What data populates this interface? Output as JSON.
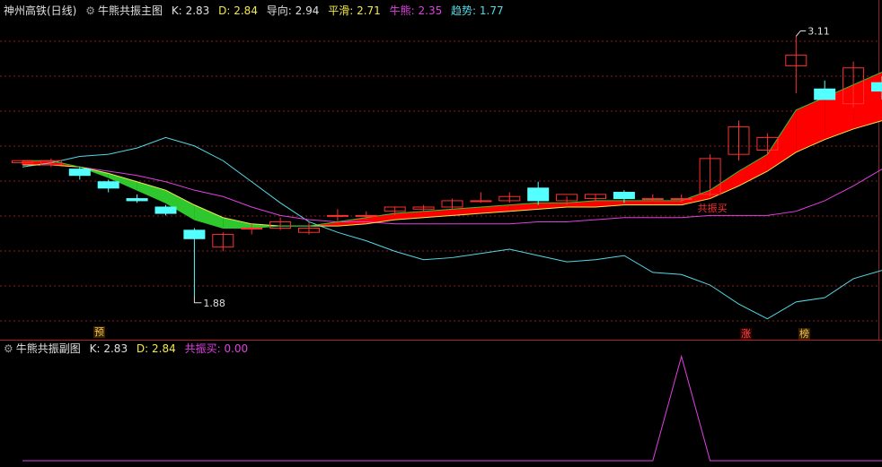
{
  "main_header": {
    "stock": "神州高铁(日线)",
    "indicator": "牛熊共振主图",
    "k_label": "K:",
    "k_value": "2.83",
    "d_label": "D:",
    "d_value": "2.84",
    "guide_label": "导向:",
    "guide_value": "2.94",
    "smooth_label": "平滑:",
    "smooth_value": "2.71",
    "bull_label": "牛熊:",
    "bull_value": "2.35",
    "trend_label": "趋势:",
    "trend_value": "1.77"
  },
  "sub_header": {
    "indicator": "牛熊共振副图",
    "k_label": "K:",
    "k_value": "2.83",
    "d_label": "D:",
    "d_value": "2.84",
    "buy_label": "共振买:",
    "buy_value": "0.00"
  },
  "markers": {
    "pre": "预",
    "rise": "涨",
    "rank": "榜"
  },
  "annotations": {
    "high": "3.11",
    "low": "1.88",
    "buy_signal": "共振买"
  },
  "colors": {
    "up": "#ff3030",
    "down": "#54ffff",
    "bull_ribbon": "#ff0000",
    "bear_ribbon": "#2ec82e",
    "guide": "#f2e94e",
    "bull_line": "#e040e0",
    "trend": "#52d9e6",
    "grid": "#8b1e1e",
    "sub_line": "#e040e0"
  },
  "chart_data": [
    {
      "type": "candlestick",
      "title": "牛熊共振主图",
      "ylim": [
        1.76,
        3.18
      ],
      "candles": [
        {
          "o": 2.51,
          "h": 2.52,
          "l": 2.5,
          "c": 2.52
        },
        {
          "o": 2.5,
          "h": 2.53,
          "l": 2.49,
          "c": 2.52
        },
        {
          "o": 2.48,
          "h": 2.49,
          "l": 2.43,
          "c": 2.45
        },
        {
          "o": 2.42,
          "h": 2.43,
          "l": 2.37,
          "c": 2.39
        },
        {
          "o": 2.34,
          "h": 2.36,
          "l": 2.32,
          "c": 2.33
        },
        {
          "o": 2.3,
          "h": 2.31,
          "l": 2.26,
          "c": 2.27
        },
        {
          "o": 2.19,
          "h": 2.2,
          "l": 1.88,
          "c": 2.15
        },
        {
          "o": 2.11,
          "h": 2.18,
          "l": 2.09,
          "c": 2.17
        },
        {
          "o": 2.2,
          "h": 2.22,
          "l": 2.17,
          "c": 2.2
        },
        {
          "o": 2.2,
          "h": 2.25,
          "l": 2.19,
          "c": 2.23
        },
        {
          "o": 2.18,
          "h": 2.23,
          "l": 2.17,
          "c": 2.2
        },
        {
          "o": 2.26,
          "h": 2.29,
          "l": 2.22,
          "c": 2.26
        },
        {
          "o": 2.26,
          "h": 2.28,
          "l": 2.24,
          "c": 2.26
        },
        {
          "o": 2.28,
          "h": 2.3,
          "l": 2.26,
          "c": 2.3
        },
        {
          "o": 2.29,
          "h": 2.31,
          "l": 2.28,
          "c": 2.3
        },
        {
          "o": 2.3,
          "h": 2.34,
          "l": 2.29,
          "c": 2.33
        },
        {
          "o": 2.33,
          "h": 2.37,
          "l": 2.32,
          "c": 2.33
        },
        {
          "o": 2.33,
          "h": 2.37,
          "l": 2.32,
          "c": 2.35
        },
        {
          "o": 2.39,
          "h": 2.42,
          "l": 2.31,
          "c": 2.33
        },
        {
          "o": 2.33,
          "h": 2.35,
          "l": 2.31,
          "c": 2.36
        },
        {
          "o": 2.34,
          "h": 2.36,
          "l": 2.33,
          "c": 2.36
        },
        {
          "o": 2.37,
          "h": 2.38,
          "l": 2.32,
          "c": 2.34
        },
        {
          "o": 2.34,
          "h": 2.36,
          "l": 2.33,
          "c": 2.34
        },
        {
          "o": 2.34,
          "h": 2.36,
          "l": 2.32,
          "c": 2.34
        },
        {
          "o": 2.36,
          "h": 2.55,
          "l": 2.35,
          "c": 2.53
        },
        {
          "o": 2.55,
          "h": 2.71,
          "l": 2.52,
          "c": 2.68
        },
        {
          "o": 2.57,
          "h": 2.65,
          "l": 2.55,
          "c": 2.63
        },
        {
          "o": 2.97,
          "h": 3.11,
          "l": 2.84,
          "c": 3.02
        },
        {
          "o": 2.86,
          "h": 2.9,
          "l": 2.84,
          "c": 2.81
        },
        {
          "o": 2.79,
          "h": 2.99,
          "l": 2.77,
          "c": 2.96
        },
        {
          "o": 2.89,
          "h": 2.92,
          "l": 2.81,
          "c": 2.85
        }
      ],
      "guide": [
        2.52,
        2.52,
        2.49,
        2.44,
        2.38,
        2.32,
        2.24,
        2.2,
        2.2,
        2.21,
        2.21,
        2.23,
        2.25,
        2.27,
        2.28,
        2.29,
        2.3,
        2.31,
        2.32,
        2.32,
        2.33,
        2.33,
        2.33,
        2.33,
        2.38,
        2.47,
        2.55,
        2.76,
        2.82,
        2.88,
        2.94
      ],
      "smooth": [
        2.5,
        2.5,
        2.49,
        2.46,
        2.42,
        2.38,
        2.31,
        2.25,
        2.22,
        2.21,
        2.21,
        2.21,
        2.22,
        2.24,
        2.25,
        2.26,
        2.27,
        2.28,
        2.29,
        2.3,
        2.3,
        2.31,
        2.31,
        2.31,
        2.34,
        2.4,
        2.47,
        2.56,
        2.62,
        2.67,
        2.71
      ],
      "bull_bear": [
        2.5,
        2.5,
        2.49,
        2.47,
        2.45,
        2.42,
        2.38,
        2.35,
        2.3,
        2.26,
        2.24,
        2.23,
        2.23,
        2.22,
        2.22,
        2.22,
        2.22,
        2.22,
        2.23,
        2.23,
        2.24,
        2.25,
        2.25,
        2.25,
        2.26,
        2.26,
        2.26,
        2.28,
        2.33,
        2.4,
        2.48
      ],
      "trend": [
        2.49,
        2.51,
        2.54,
        2.55,
        2.58,
        2.63,
        2.59,
        2.52,
        2.42,
        2.32,
        2.23,
        2.18,
        2.14,
        2.09,
        2.05,
        2.06,
        2.08,
        2.1,
        2.07,
        2.04,
        2.05,
        2.07,
        1.99,
        1.98,
        1.93,
        1.84,
        1.77,
        1.85,
        1.87,
        1.96,
        2.0
      ]
    },
    {
      "type": "line",
      "title": "牛熊共振副图",
      "ylim": [
        0,
        1.1
      ],
      "values": [
        0,
        0,
        0,
        0,
        0,
        0,
        0,
        0,
        0,
        0,
        0,
        0,
        0,
        0,
        0,
        0,
        0,
        0,
        0,
        0,
        0,
        0,
        0,
        1,
        0,
        0,
        0,
        0,
        0,
        0,
        0
      ]
    }
  ]
}
